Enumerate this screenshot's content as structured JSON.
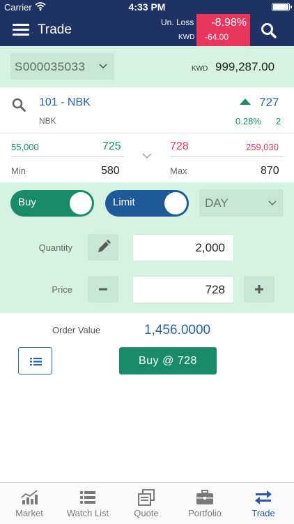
{
  "status_bar": {
    "carrier": "Carrier",
    "time": "4:33 PM"
  },
  "header": {
    "title": "Trade",
    "unrealized_label": "Un. Loss",
    "currency": "KWD",
    "unrealized_pct": "-8.98%",
    "unrealized_amount": "-64.00",
    "loss_color": "#e8365d"
  },
  "account": {
    "number": "S000035033",
    "balance_currency": "KWD",
    "balance": "999,287.00"
  },
  "symbol": {
    "code": "101 - NBK",
    "name": "NBK",
    "last_price": "727",
    "change_pct": "0.28%",
    "change": "2",
    "direction": "up"
  },
  "market_depth": {
    "bid_qty": "55,000",
    "bid_price": "725",
    "ask_price": "728",
    "ask_qty": "259,030",
    "min_label": "Min",
    "min_value": "580",
    "max_label": "Max",
    "max_value": "870"
  },
  "order": {
    "side_label": "Buy",
    "type_label": "Limit",
    "validity": "DAY",
    "quantity_label": "Quantity",
    "quantity": "2,000",
    "price_label": "Price",
    "price": "728",
    "order_value_label": "Order Value",
    "order_value": "1,456.0000",
    "submit_label": "Buy @ 728"
  },
  "colors": {
    "header_bg": "#1e3263",
    "panel_bg": "#d6f2e2",
    "buy_green": "#1a8b69",
    "limit_blue": "#1e5a97",
    "accent_blue": "#2a63a5"
  },
  "tabs": [
    {
      "label": "Market",
      "icon": "chart-bar-icon"
    },
    {
      "label": "Watch List",
      "icon": "list-icon"
    },
    {
      "label": "Quote",
      "icon": "quote-stack-icon"
    },
    {
      "label": "Portfolio",
      "icon": "briefcase-icon"
    },
    {
      "label": "Trade",
      "icon": "swap-arrows-icon",
      "active": true
    }
  ]
}
